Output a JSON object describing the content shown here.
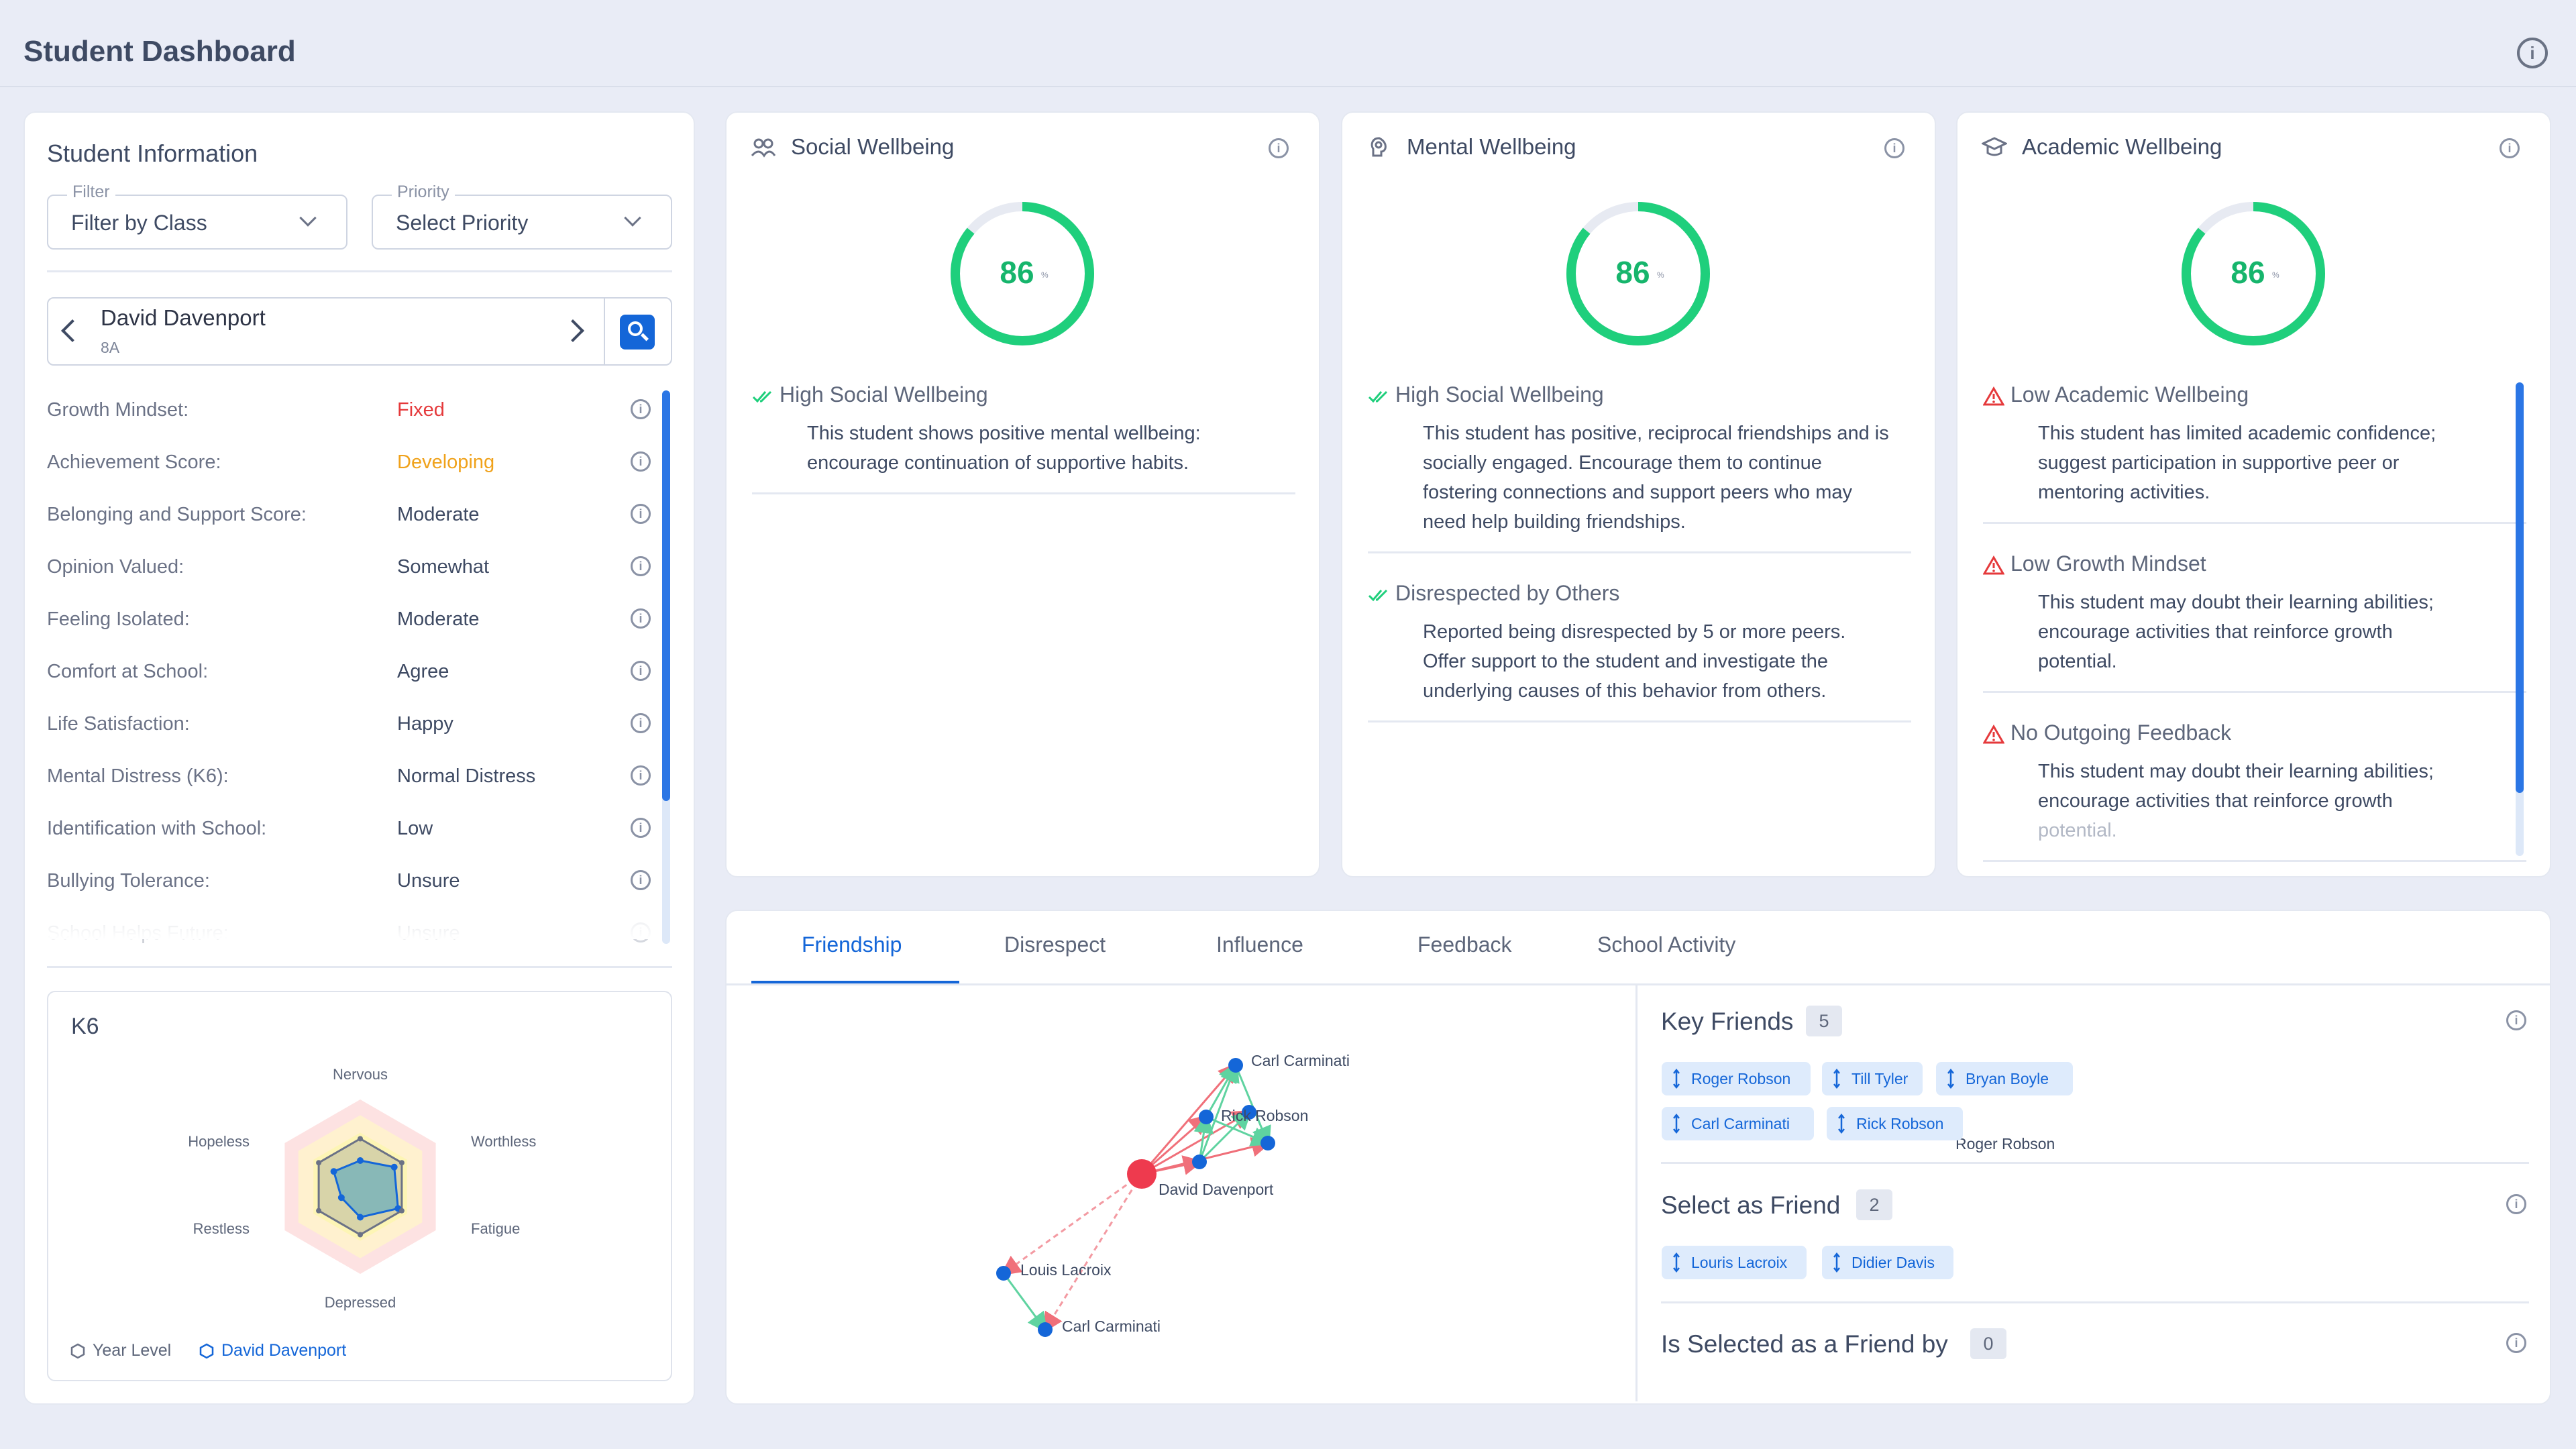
{
  "header": {
    "title": "Student Dashboard"
  },
  "student_info": {
    "title": "Student Information",
    "filter": {
      "label": "Filter",
      "value": "Filter by Class"
    },
    "priority": {
      "label": "Priority",
      "value": "Select Priority"
    },
    "student": {
      "name": "David Davenport",
      "class": "8A"
    },
    "attributes": [
      {
        "key": "Growth Mindset:",
        "value": "Fixed",
        "color": "#e5393b"
      },
      {
        "key": "Achievement Score:",
        "value": "Developing",
        "color": "#f0a21b"
      },
      {
        "key": "Belonging and Support Score:",
        "value": "Moderate",
        "color": "#3e4a63"
      },
      {
        "key": "Opinion Valued:",
        "value": "Somewhat",
        "color": "#3e4a63"
      },
      {
        "key": "Feeling Isolated:",
        "value": "Moderate",
        "color": "#3e4a63"
      },
      {
        "key": "Comfort at School:",
        "value": "Agree",
        "color": "#3e4a63"
      },
      {
        "key": "Life Satisfaction:",
        "value": "Happy",
        "color": "#3e4a63"
      },
      {
        "key": "Mental Distress (K6):",
        "value": "Normal Distress",
        "color": "#3e4a63"
      },
      {
        "key": "Identification with School:",
        "value": "Low",
        "color": "#3e4a63"
      },
      {
        "key": "Bullying Tolerance:",
        "value": "Unsure",
        "color": "#3e4a63"
      },
      {
        "key": "School Helps Future:",
        "value": "Unsure",
        "color": "#3e4a63"
      }
    ]
  },
  "k6": {
    "title": "K6",
    "axes": [
      "Nervous",
      "Worthless",
      "Fatigue",
      "Depressed",
      "Restless",
      "Hopeless"
    ],
    "year_level": [
      0.55,
      0.55,
      0.55,
      0.55,
      0.55,
      0.55
    ],
    "student_values": [
      0.3,
      0.45,
      0.5,
      0.35,
      0.25,
      0.35
    ],
    "legend": {
      "year_level": "Year Level",
      "student": "David Davenport"
    }
  },
  "wellbeing": [
    {
      "title": "Social Wellbeing",
      "icon": "people-icon",
      "score": 86,
      "unit": "%",
      "notes": [
        {
          "status": "ok",
          "heading": "High Social Wellbeing",
          "lines": [
            "This student shows positive mental wellbeing:",
            "encourage continuation of supportive habits."
          ]
        }
      ]
    },
    {
      "title": "Mental Wellbeing",
      "icon": "brain-icon",
      "score": 86,
      "unit": "%",
      "notes": [
        {
          "status": "ok",
          "heading": "High Social Wellbeing",
          "lines": [
            "This student has positive, reciprocal friendships and is",
            "socially engaged. Encourage them to continue",
            "fostering connections and support peers who may",
            "need help building friendships."
          ]
        },
        {
          "status": "ok",
          "heading": "Disrespected by Others",
          "lines": [
            "Reported being disrespected by 5 or more peers.",
            "Offer support to the student and investigate the",
            "underlying causes of this behavior from others."
          ]
        }
      ]
    },
    {
      "title": "Academic Wellbeing",
      "icon": "graduation-cap-icon",
      "score": 86,
      "unit": "%",
      "notes": [
        {
          "status": "warn",
          "heading": "Low Academic Wellbeing",
          "lines": [
            "This student has limited academic confidence;",
            "suggest participation in supportive peer or",
            "mentoring activities."
          ]
        },
        {
          "status": "warn",
          "heading": "Low Growth Mindset",
          "lines": [
            "This student may doubt their learning abilities;",
            "encourage activities that reinforce growth",
            "potential."
          ]
        },
        {
          "status": "warn",
          "heading": "No Outgoing Feedback",
          "lines": [
            "This student may doubt their learning abilities;",
            "encourage activities that reinforce growth",
            "potential."
          ]
        }
      ]
    }
  ],
  "tabs": [
    "Friendship",
    "Disrespect",
    "Influence",
    "Feedback",
    "School Activity"
  ],
  "active_tab": "Friendship",
  "network": {
    "center": "David Davenport",
    "nodes": [
      "Carl Carminati",
      "Rick Robson",
      "Roger Robson",
      "David Davenport",
      "Louis Lacroix",
      "Carl Carminati"
    ]
  },
  "friends": {
    "key_friends": {
      "title": "Key Friends",
      "count": "5",
      "names": [
        "Roger Robson",
        "Till Tyler",
        "Bryan Boyle",
        "Carl Carminati",
        "Rick Robson"
      ]
    },
    "select_as_friend": {
      "title": "Select as Friend",
      "count": "2",
      "names": [
        "Louris Lacroix",
        "Didier Davis"
      ]
    },
    "selected_by": {
      "title": "Is Selected as a Friend by",
      "count": "0"
    }
  },
  "colors": {
    "accent": "#1466d8",
    "gauge": "#1fcf7c",
    "warn": "#e5393b",
    "ok": "#1fcf7c"
  }
}
